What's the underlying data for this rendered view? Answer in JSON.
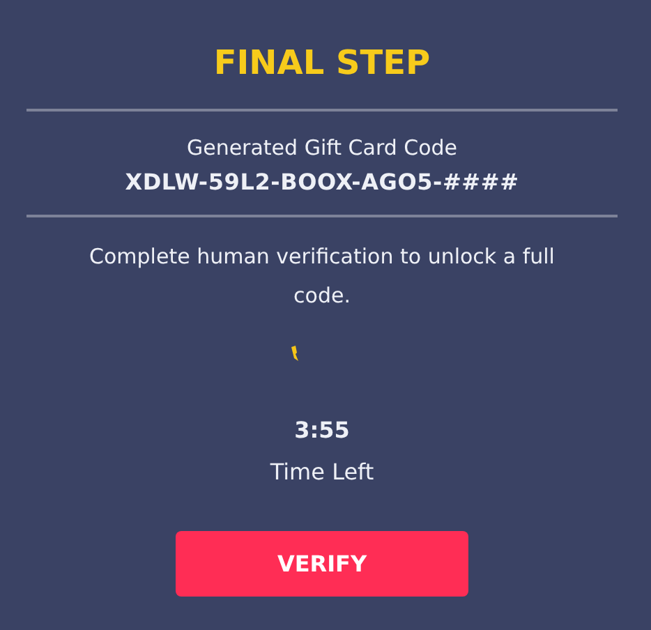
{
  "title": "FINAL STEP",
  "code": {
    "label": "Generated Gift Card Code",
    "value": "XDLW-59L2-BOOX-AGO5-####"
  },
  "message": "Complete human verification to unlock a full code.",
  "timer": {
    "value": "3:55",
    "label": "Time Left"
  },
  "button": {
    "label": "VERIFY"
  }
}
